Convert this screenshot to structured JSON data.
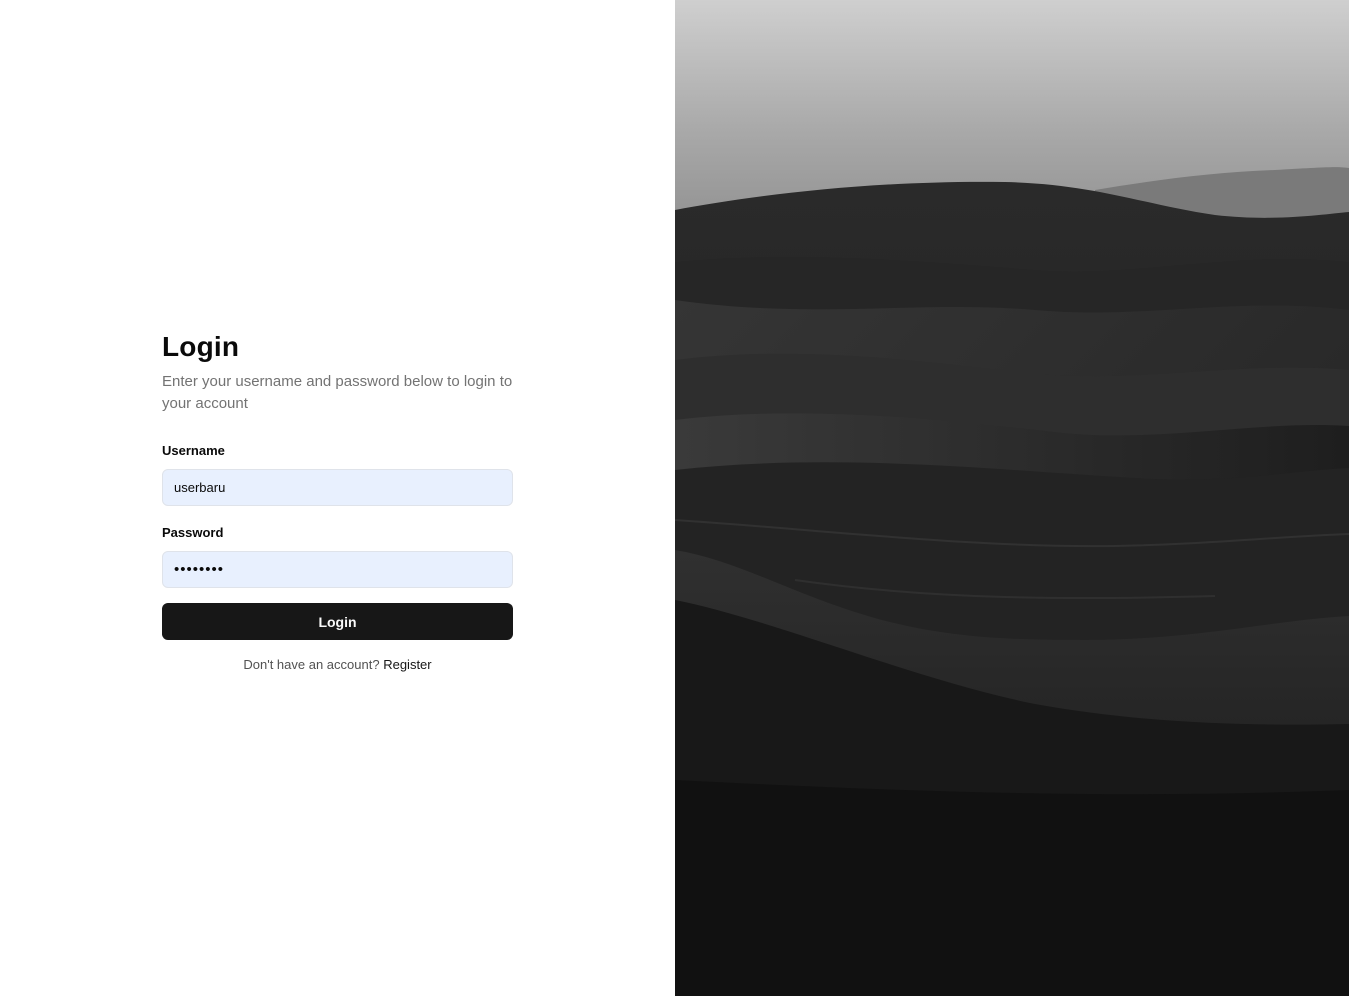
{
  "login": {
    "title": "Login",
    "subtitle": "Enter your username and password below to login to your account",
    "username_label": "Username",
    "username_value": "userbaru",
    "password_label": "Password",
    "password_value": "password",
    "button_label": "Login",
    "footer_text": "Don't have an account?",
    "register_label": "Register"
  },
  "hero": {
    "image_name": "desert-dunes-photo"
  },
  "colors": {
    "button_bg": "#171717",
    "input_bg": "#e8f0fe",
    "muted_text": "#737373"
  }
}
